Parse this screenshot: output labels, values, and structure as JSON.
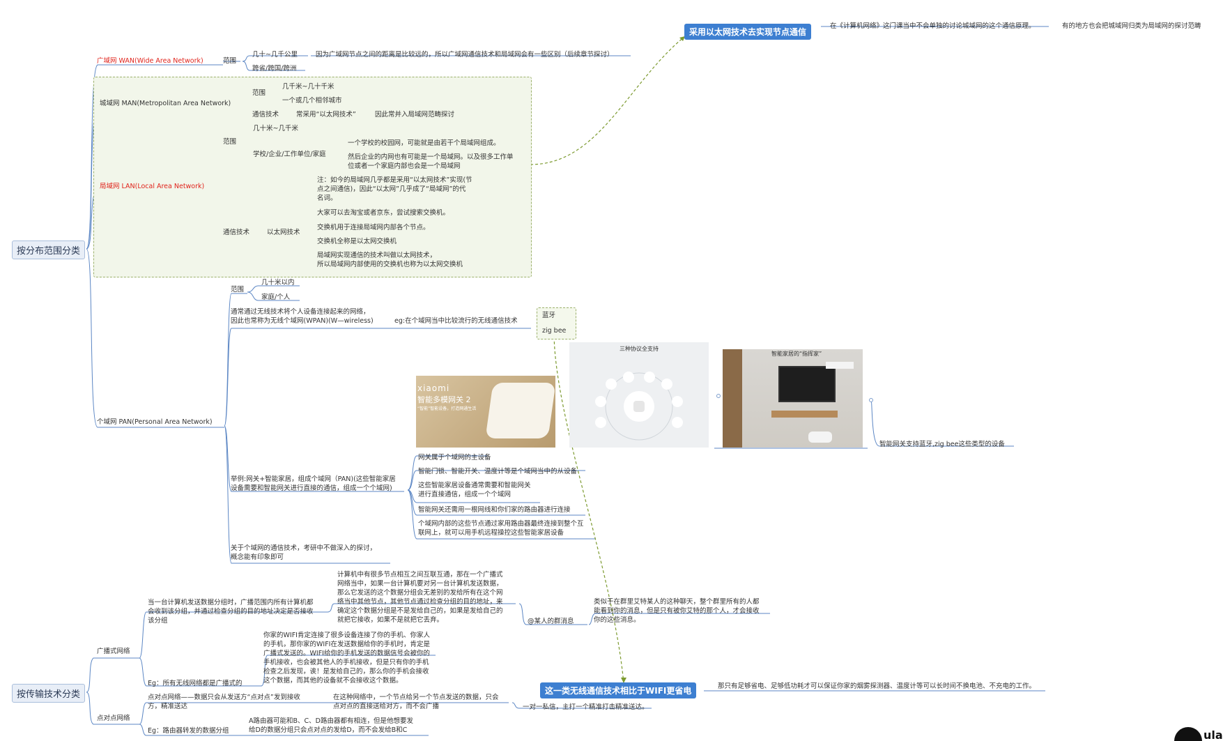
{
  "roots": {
    "distribution": "按分布范围分类",
    "transmission": "按传输技术分类"
  },
  "wan": {
    "title": "广域网 WAN(Wide Area Network)",
    "range_label": "范围",
    "range_1": "几十~几千公里",
    "range_1_note": "因为广域网节点之间的距离是比较远的，所以广域网通信技术和局域网会有一些区别（后续章节探讨）",
    "range_2": "跨省/跨国/跨洲"
  },
  "man": {
    "title": "城域网 MAN(Metropolitan Area Network)",
    "range_label": "范围",
    "range_1": "几千米~几十千米",
    "range_2": "一个或几个相邻城市",
    "tech_label": "通信技术",
    "tech_value": "常采用“以太网技术”",
    "tech_note": "因此常并入局域网范畴探讨"
  },
  "lan": {
    "title": "局域网 LAN(Local Area Network)",
    "range_label": "范围",
    "range_1": "几十米~几千米",
    "range_2": "学校/企业/工作单位/家庭",
    "example_1": "一个学校的校园网，可能就是由若干个局域网组成。",
    "example_2": "然后企业的内网也有可能是一个局域网。以及很多工作单\n位或者一个家庭内部也会是一个局域网",
    "tech_label": "通信技术",
    "tech_value": "以太网技术",
    "eth_1": "注：如今的局域网几乎都是采用“以太网技术”实现(节\n点之间通信)，因此“以太网”几乎成了“局域网”的代\n名词。",
    "eth_2": "大家可以去淘宝或者京东，尝试搜索交换机。",
    "eth_3": "交换机用于连接局域网内部各个节点。",
    "eth_4": "交换机全称是以太网交换机",
    "eth_5": "局域网实现通信的技术叫做以太网技术，\n所以局域网内部使用的交换机也称为以太网交换机"
  },
  "callout_ethernet": {
    "label": "采用以太网技术去实现节点通信",
    "note_1": "在《计算机网络》这门课当中不会单独的讨论城域网的这个通信原理。",
    "note_2": "有的地方也会把城域网归类为局域网的探讨范畴"
  },
  "pan": {
    "title": "个域网 PAN(Personal Area Network)",
    "range_label": "范围",
    "range_1": "几十米以内",
    "range_2": "家庭/个人",
    "wireless_desc": "通常通过无线技术将个人设备连接起来的网络，\n因此也常称为无线个域网(WPAN)(W—wireless)",
    "wireless_eg": "eg:在个域网当中比较流行的无线通信技术",
    "tech_1": "蓝牙",
    "tech_2": "zig bee",
    "gateway_note": "智能网关支持蓝牙,zig bee这些类型的设备",
    "example_desc": "举例:网关+智能家居，组成个域网（PAN)(这些智能家居\n设备需要和智能网关进行直接的通信，组成一个个域网)",
    "ex_1": "网关属于个域网的主设备",
    "ex_2": "智能门锁、智能开关、温度计等是个域网当中的从设备",
    "ex_3": "这些智能家居设备通常需要和智能网关\n进行直接通信，组成一个个域网",
    "ex_4": "智能网关还需用一根网线和你们家的路由器进行连接",
    "ex_5": "个域网内部的这些节点通过家用路由器最终连接到整个互\n联网上，就可以用手机远程操控这些智能家居设备",
    "study_note": "关于个域网的通信技术，考研中不做深入的探讨，\n概念能有印象即可",
    "image_1_brand": "xiaomi",
    "image_1_title": "智能多模网关 2",
    "image_1_sub": "“智能”智能设备，打造网通生活",
    "image_2_title": "三种协议全支持",
    "image_3_title": "智能家居的“指挥家”"
  },
  "broadcast": {
    "label": "广播式网络",
    "desc": "当一台计算机发送数据分组时，广播范围内所有计算机都\n会收到该分组，并通过检查分组的目的地址决定是否接收\n该分组",
    "detail": "计算机中有很多节点相互之间互联互通，那在一个广播式\n网络当中，如果一台计算机要对另一台计算机发送数据，\n那么它发送的这个数据分组会无差别的发给所有在这个网\n络当中其他节点，其他节点通过检查分组的目的地址，来\n确定这个数据分组是不是发给自己的，如果是发给自己的\n就把它接收，如果不是就把它丢弃。",
    "at_label": "@某人的群消息",
    "at_note": "类似于在群里艾特某人的这种聊天，整个群里所有的人都\n能看到你的消息，但是只有被你艾特的那个人，才会接收\n你的这些消息。",
    "eg_label": "Eg：所有无线网络都是广播式的",
    "eg_detail": "你家的WIFI肯定连接了很多设备连接了你的手机、你家人\n的手机，那你家的WIFI在发送数据给你的手机时，肯定是\n广播式发送的。WIFI给你的手机发送的数据信号会被你的\n手机接收，也会被其他人的手机接收，但是只有你的手机\n检查之后发现，诶！是发给自己的，那么你的手机会接收\n这个数据，而其他的设备就不会接收这个数据。"
  },
  "callout_wireless": {
    "label": "这一类无线通信技术相比于WIFI更省电",
    "note": "那只有足够省电、足够低功耗才可以保证你家的烟雾探测器、温度计等可以长时间不换电池、不充电的工作。"
  },
  "p2p": {
    "label": "点对点网络",
    "desc": "点对点网络——数据只会从发送方“点对点”发到接收\n方，精准送达",
    "detail": "在这种网络中，一个节点给另一个节点发送的数据，只会\n点对点的直接送给对方，而不会广播",
    "detail_note": "一对一私信，主打一个精准打击精准送达。",
    "eg_label": "Eg：路由器转发的数据分组",
    "eg_detail": "A路由器可能和B、C、D路由器都有相连，但是他想要发\n给D的数据分组只会点对点的发给D，而不会发给B和C"
  },
  "logo_text": "ula"
}
